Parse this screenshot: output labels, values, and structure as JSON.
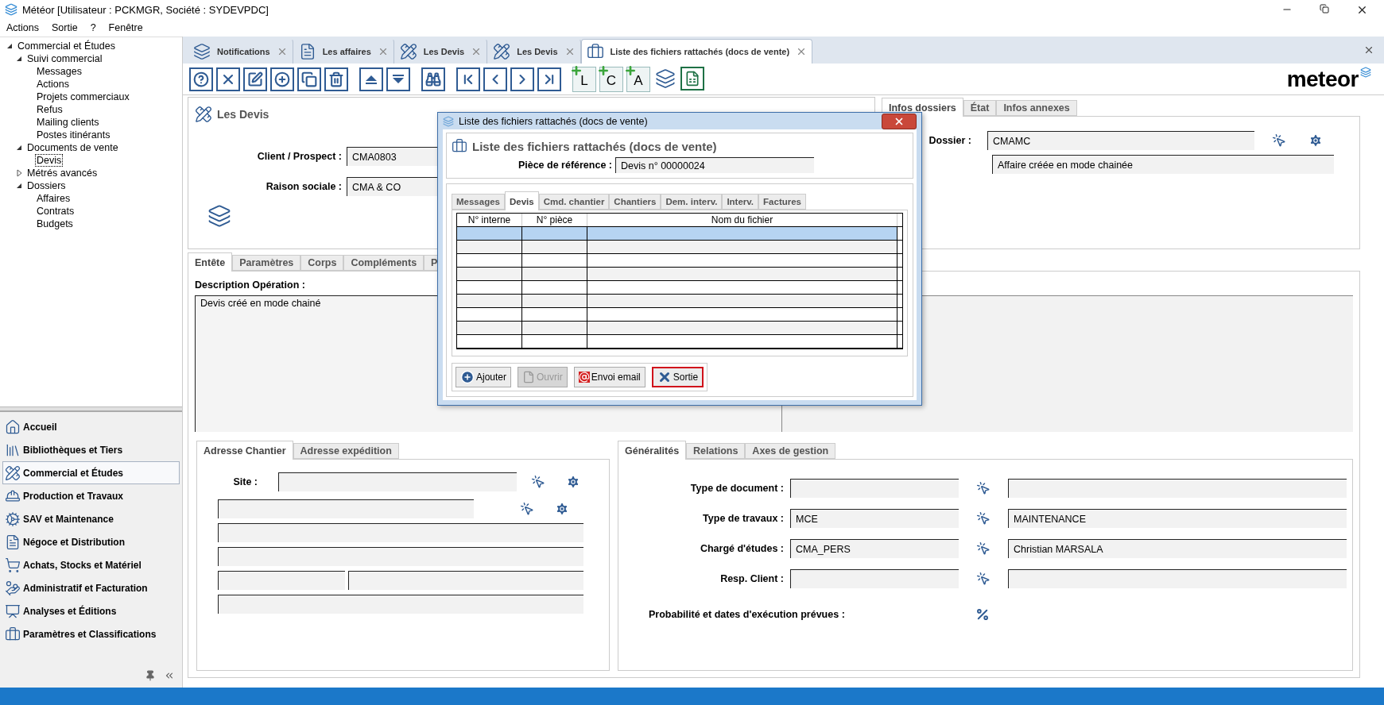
{
  "window": {
    "title": "Météor [Utilisateur : PCKMGR, Société : SYDEVPDC]"
  },
  "menu": [
    "Actions",
    "Sortie",
    "?",
    "Fenêtre"
  ],
  "tree": [
    {
      "label": "Commercial et Études",
      "expanded": true,
      "children": [
        {
          "label": "Suivi commercial",
          "expanded": true,
          "children": [
            {
              "label": "Messages",
              "selected": false
            },
            {
              "label": "Actions",
              "selected": false
            },
            {
              "label": "Projets commerciaux",
              "selected": false
            },
            {
              "label": "Refus",
              "selected": false
            },
            {
              "label": "Mailing clients",
              "selected": false
            },
            {
              "label": "Postes itinérants",
              "selected": false
            }
          ]
        },
        {
          "label": "Documents de vente",
          "expanded": true,
          "children": [
            {
              "label": "Devis",
              "selected": true
            }
          ]
        },
        {
          "label": "Métrés avancés",
          "expanded": false
        },
        {
          "label": "Dossiers",
          "expanded": true,
          "children": [
            {
              "label": "Affaires",
              "selected": false
            },
            {
              "label": "Contrats",
              "selected": false
            },
            {
              "label": "Budgets",
              "selected": false
            }
          ]
        }
      ]
    }
  ],
  "modules": [
    {
      "label": "Accueil",
      "selected": false
    },
    {
      "label": "Bibliothèques et Tiers",
      "selected": false
    },
    {
      "label": "Commercial et Études",
      "selected": true
    },
    {
      "label": "Production et Travaux",
      "selected": false
    },
    {
      "label": "SAV et Maintenance",
      "selected": false
    },
    {
      "label": "Négoce et Distribution",
      "selected": false
    },
    {
      "label": "Achats, Stocks et Matériel",
      "selected": false
    },
    {
      "label": "Administratif et Facturation",
      "selected": false
    },
    {
      "label": "Analyses et Éditions",
      "selected": false
    },
    {
      "label": "Paramètres et Classifications",
      "selected": false
    }
  ],
  "doc_tabs": [
    {
      "label": "Notifications",
      "selected": false
    },
    {
      "label": "Les affaires",
      "selected": false
    },
    {
      "label": "Les Devis",
      "selected": false
    },
    {
      "label": "Les Devis",
      "selected": false
    },
    {
      "label": "Liste des fichiers rattachés (docs de vente)",
      "selected": true
    }
  ],
  "toolbar": {
    "add_buttons": [
      "L",
      "C",
      "A"
    ]
  },
  "logo": "meteor",
  "document": {
    "title": "Les Devis",
    "client_label": "Client / Prospect :",
    "client": "CMA0803",
    "raison_label": "Raison sociale :",
    "raison": "CMA & CO"
  },
  "info_tabs": [
    {
      "label": "Infos dossiers",
      "selected": true
    },
    {
      "label": "État",
      "selected": false
    },
    {
      "label": "Infos annexes",
      "selected": false
    }
  ],
  "info": {
    "dossier_label": "Dossier :",
    "dossier": "CMAMC",
    "dossier_desc": "Affaire créée en mode chainée"
  },
  "main_tabs": [
    {
      "label": "Entête",
      "selected": true
    },
    {
      "label": "Paramètres",
      "selected": false
    },
    {
      "label": "Corps",
      "selected": false
    },
    {
      "label": "Compléments",
      "selected": false
    },
    {
      "label": "P",
      "selected": false
    }
  ],
  "description": {
    "label": "Description Opération :",
    "value": "Devis créé en mode chainé"
  },
  "address_tabs": [
    {
      "label": "Adresse Chantier",
      "selected": true
    },
    {
      "label": "Adresse expédition",
      "selected": false
    }
  ],
  "address": {
    "site_label": "Site :"
  },
  "general_tabs": [
    {
      "label": "Généralités",
      "selected": true
    },
    {
      "label": "Relations",
      "selected": false
    },
    {
      "label": "Axes de gestion",
      "selected": false
    }
  ],
  "general_rows": [
    {
      "label": "Type de document :"
    },
    {
      "label": "Type de travaux :",
      "code": "MCE",
      "name": "MAINTENANCE"
    },
    {
      "label": "Chargé d'études :",
      "code": "CMA_PERS",
      "name": "Christian MARSALA"
    },
    {
      "label": "Resp. Client :"
    }
  ],
  "probability_label": "Probabilité et dates d'exécution prévues :",
  "dialog": {
    "title": "Liste des fichiers rattachés (docs de vente)",
    "heading": "Liste des fichiers rattachés (docs de vente)",
    "reference_label": "Pièce de référence :",
    "reference": "Devis n° 00000024",
    "tabs": [
      {
        "label": "Messages",
        "selected": false
      },
      {
        "label": "Devis",
        "selected": true
      },
      {
        "label": "Cmd. chantier",
        "selected": false
      },
      {
        "label": "Chantiers",
        "selected": false
      },
      {
        "label": "Dem. interv.",
        "selected": false
      },
      {
        "label": "Interv.",
        "selected": false
      },
      {
        "label": "Factures",
        "selected": false
      }
    ],
    "columns": [
      "N° interne",
      "N° pièce",
      "Nom du fichier"
    ],
    "rows": [
      {
        "selected": true
      },
      {
        "selected": false
      },
      {
        "selected": false
      },
      {
        "selected": false
      },
      {
        "selected": false
      },
      {
        "selected": false
      },
      {
        "selected": false
      },
      {
        "selected": false
      },
      {
        "selected": false
      }
    ],
    "buttons": [
      {
        "kind": "add",
        "label": "Ajouter",
        "disabled": false,
        "focused": false
      },
      {
        "kind": "open",
        "label": "Ouvrir",
        "disabled": true,
        "focused": false
      },
      {
        "kind": "email",
        "label": "Envoi email",
        "disabled": false,
        "focused": false
      },
      {
        "kind": "exit",
        "label": "Sortie",
        "disabled": false,
        "focused": true
      }
    ]
  }
}
